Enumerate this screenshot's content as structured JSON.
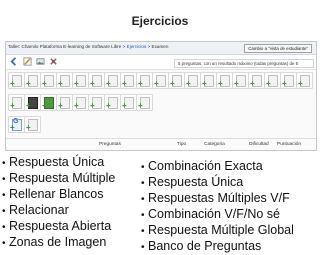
{
  "slide": {
    "title": "Ejercicios"
  },
  "screenshot": {
    "breadcrumb": {
      "prefix": "Taller: Chamilo Plataforma E-learning de Software Libre",
      "sep": ">",
      "link": "Ejercicios",
      "sep2": ">",
      "current": "Examen"
    },
    "change_view_button": "Cambio a \"vista de estudiante\"",
    "info_text": "5 preguntas, con un resultado máximo (todas preguntas) de 5",
    "toolbar_icons": [
      "back-icon",
      "edit-icon",
      "image-icon",
      "settings-icon"
    ],
    "grid_rows": [
      [
        {
          "kind": "plain"
        },
        {
          "kind": "plain"
        },
        {
          "kind": "plain"
        },
        {
          "kind": "plain"
        },
        {
          "kind": "plain"
        },
        {
          "kind": "plain"
        },
        {
          "kind": "plain"
        },
        {
          "kind": "plain"
        },
        {
          "kind": "plain"
        },
        {
          "kind": "plain"
        },
        {
          "kind": "plain"
        },
        {
          "kind": "plain"
        },
        {
          "kind": "plain"
        },
        {
          "kind": "plain"
        },
        {
          "kind": "plain"
        },
        {
          "kind": "plain"
        },
        {
          "kind": "plain"
        },
        {
          "kind": "plain"
        },
        {
          "kind": "plain"
        }
      ],
      [
        {
          "kind": "plain"
        },
        {
          "kind": "dark"
        },
        {
          "kind": "green"
        },
        {
          "kind": "plain"
        },
        {
          "kind": "plain"
        },
        {
          "kind": "plain"
        },
        {
          "kind": "plain"
        },
        {
          "kind": "plain"
        },
        {
          "kind": "plain"
        }
      ],
      [
        {
          "kind": "blue",
          "glyph": "G"
        },
        {
          "kind": "plain"
        }
      ]
    ],
    "table_headers": [
      "Preguntas",
      "Tipo",
      "Categoria",
      "Dificultad",
      "Puntuación"
    ]
  },
  "left_list": [
    "Respuesta Única",
    "Respuesta Múltiple",
    "Rellenar Blancos",
    "Relacionar",
    "Respuesta Abierta",
    "Zonas de Imagen"
  ],
  "right_list": [
    "Combinación Exacta",
    "Respuesta Única",
    "Respuestas Múltiples V/F",
    "Combinación V/F/No sé",
    "Respuesta Múltiple Global",
    "Banco de Preguntas"
  ]
}
